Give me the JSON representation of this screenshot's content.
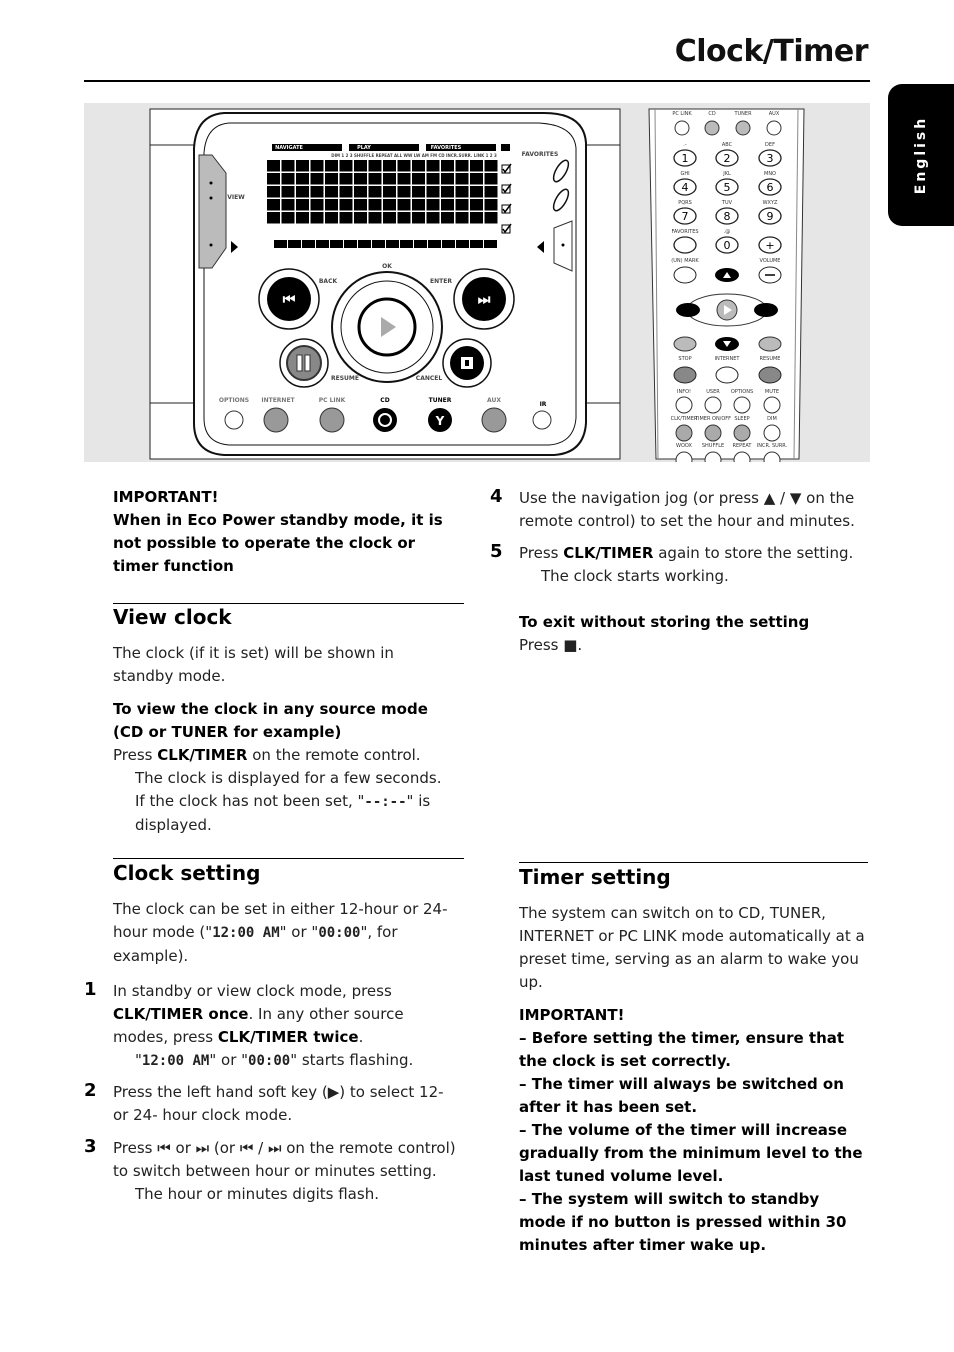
{
  "header": {
    "title": "Clock/Timer",
    "language_tab": "English"
  },
  "figure": {
    "unit_labels": {
      "view": "VIEW",
      "favorites": "FAVORITES",
      "ok": "OK",
      "back": "BACK",
      "enter": "ENTER",
      "resume": "RESUME",
      "cancel": "CANCEL",
      "ir": "IR",
      "sources": [
        "OPTIONS",
        "INTERNET",
        "PC LINK",
        "CD",
        "TUNER",
        "AUX"
      ],
      "display_tabs": [
        "NAVIGATE",
        "PLAY",
        "FAVORITES"
      ],
      "display_indicators": "DIM 1 2 3  SHUFFLE  REPEAT ALL  WW  LW AM FM  CD  INCR.SURR.  LINK  1 2 3"
    },
    "remote_labels": {
      "sources": [
        "PC LINK",
        "CD",
        "TUNER",
        "AUX"
      ],
      "keys": [
        {
          "top": ".-",
          "digit": "1"
        },
        {
          "top": "ABC",
          "digit": "2"
        },
        {
          "top": "DEF",
          "digit": "3"
        },
        {
          "top": "GHI",
          "digit": "4"
        },
        {
          "top": "JKL",
          "digit": "5"
        },
        {
          "top": "MNO",
          "digit": "6"
        },
        {
          "top": "PQRS",
          "digit": "7"
        },
        {
          "top": "TUV",
          "digit": "8"
        },
        {
          "top": "WXYZ",
          "digit": "9"
        },
        {
          "top": "FAVORITES",
          "digit": ""
        },
        {
          "top": ".@",
          "digit": "0"
        },
        {
          "top": "",
          "digit": "+"
        }
      ],
      "mark": "(UN) MARK",
      "volume": "VOLUME",
      "row_stop": [
        "STOP",
        "INTERNET",
        "RESUME"
      ],
      "row_info": [
        "INFO!",
        "USER",
        "OPTIONS",
        "MUTE"
      ],
      "row_clk": [
        "CLK/TIMER",
        "TIMER ON/OFF",
        "SLEEP",
        "DIM"
      ],
      "row_wox": [
        "WOOX",
        "SHUFFLE",
        "REPEAT",
        "INCR. SURR."
      ]
    }
  },
  "left": {
    "important_heading": "IMPORTANT!",
    "important_text": "When in Eco Power standby mode, it is not possible to operate the clock or timer function",
    "view_clock": {
      "heading": "View clock",
      "intro": "The clock (if it is set) will be shown in standby mode.",
      "sub_heading": "To view the clock in any source mode (CD or TUNER for example)",
      "press": "Press ",
      "press_key": "CLK/TIMER",
      "press_rest": " on the remote control.",
      "line2": "The clock is displayed for a few seconds.",
      "line3a": "If the clock has not been set, \"",
      "line3_code": "--:--",
      "line3b": "\" is displayed."
    },
    "clock_setting": {
      "heading": "Clock setting",
      "intro_a": "The clock can be set in either 12-hour or 24-hour mode (\"",
      "code12": "12:00 AM",
      "intro_b": "\" or \"",
      "code24": "00:00",
      "intro_c": "\", for example).",
      "steps": [
        {
          "num": "1",
          "a": "In standby or view clock mode, press ",
          "b": "CLK/TIMER once",
          "c": ".  In any other source modes, press ",
          "d": "CLK/TIMER twice",
          "e": ".",
          "sub_a": "\"",
          "sub_code1": "12:00 AM",
          "sub_b": "\" or \"",
          "sub_code2": "00:00",
          "sub_c": "\" starts flashing."
        },
        {
          "num": "2",
          "text": "Press the left hand soft key (▶) to select 12- or 24- hour clock mode."
        },
        {
          "num": "3",
          "text": "Press ⏮ or ⏭  (or ⏮ / ⏭  on the remote control) to switch between hour or minutes setting.",
          "sub": "The hour or minutes digits flash."
        }
      ]
    }
  },
  "right": {
    "steps": [
      {
        "num": "4",
        "text": "Use the navigation jog (or press ▲ / ▼  on the remote control) to set the hour and minutes."
      },
      {
        "num": "5",
        "a": "Press ",
        "b": "CLK/TIMER",
        "c": " again to store the setting.",
        "sub": "The clock starts working."
      }
    ],
    "exit_heading": "To exit without storing the setting",
    "exit_text": "Press  ■.",
    "timer_setting": {
      "heading": "Timer setting",
      "intro": "The system can switch on to CD, TUNER, INTERNET or PC LINK mode automatically at a preset time, serving as an alarm to wake you up.",
      "important_heading": "IMPORTANT!",
      "notes": [
        "–  Before setting the timer, ensure that the clock is set correctly.",
        "–  The timer will always be switched on after it has been set.",
        "–  The volume of the timer will increase gradually from the minimum level to the last tuned volume level.",
        "–  The system will switch to standby mode if no button is pressed within 30 minutes after timer wake up."
      ]
    }
  }
}
